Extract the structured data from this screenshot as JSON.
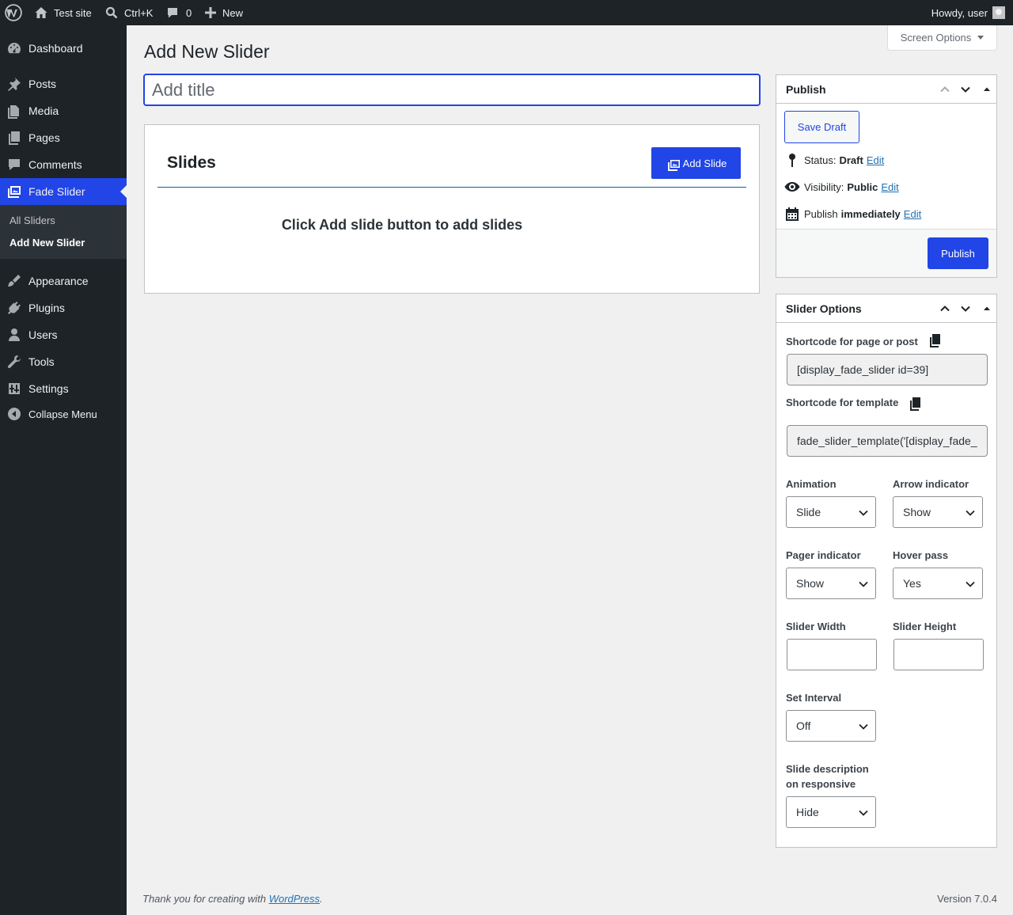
{
  "admin_bar": {
    "site_name": "Test site",
    "search_shortcut": "Ctrl+K",
    "comments_count": "0",
    "new_label": "New",
    "greeting": "Howdy, user"
  },
  "sidebar": {
    "items": [
      {
        "label": "Dashboard",
        "icon": "dashboard-icon"
      },
      {
        "label": "Posts",
        "icon": "pin-icon"
      },
      {
        "label": "Media",
        "icon": "media-icon"
      },
      {
        "label": "Pages",
        "icon": "pages-icon"
      },
      {
        "label": "Comments",
        "icon": "comment-icon"
      },
      {
        "label": "Fade Slider",
        "icon": "slides-icon"
      },
      {
        "label": "Appearance",
        "icon": "brush-icon"
      },
      {
        "label": "Plugins",
        "icon": "plug-icon"
      },
      {
        "label": "Users",
        "icon": "user-icon"
      },
      {
        "label": "Tools",
        "icon": "wrench-icon"
      },
      {
        "label": "Settings",
        "icon": "settings-icon"
      },
      {
        "label": "Collapse Menu",
        "icon": "collapse-icon"
      }
    ],
    "submenu": [
      "All Sliders",
      "Add New Slider"
    ],
    "active_color": "#2145e6"
  },
  "header": {
    "screen_options": "Screen Options",
    "page_title": "Add New Slider"
  },
  "title_field": {
    "placeholder": "Add title",
    "value": ""
  },
  "slides_box": {
    "title": "Slides",
    "add_button": "Add Slide",
    "empty_message": "Click Add slide button to add slides"
  },
  "publish_box": {
    "title": "Publish",
    "save_draft": "Save Draft",
    "status_label": "Status:",
    "status_value": "Draft",
    "visibility_label": "Visibility:",
    "visibility_value": "Public",
    "publish_label": "Publish",
    "publish_value": "immediately",
    "edit": "Edit",
    "publish_button": "Publish"
  },
  "slider_options": {
    "title": "Slider Options",
    "shortcode_post_label": "Shortcode for page or post",
    "shortcode_post_value": "[display_fade_slider id=39]",
    "shortcode_template_label": "Shortcode for template",
    "shortcode_template_value": "fade_slider_template('[display_fade_",
    "animation_label": "Animation",
    "animation_value": "Slide",
    "arrow_label": "Arrow indicator",
    "arrow_value": "Show",
    "pager_label": "Pager indicator",
    "pager_value": "Show",
    "hover_label": "Hover pass",
    "hover_value": "Yes",
    "width_label": "Slider Width",
    "width_value": "",
    "height_label": "Slider Height",
    "height_value": "",
    "interval_label": "Set Interval",
    "interval_value": "Off",
    "desc_label_line1": "Slide description",
    "desc_label_line2": "on responsive",
    "desc_value": "Hide"
  },
  "footer": {
    "thanks_prefix": "Thank you for creating with ",
    "wordpress_link": "WordPress",
    "thanks_suffix": ".",
    "version": "Version 7.0.4"
  }
}
